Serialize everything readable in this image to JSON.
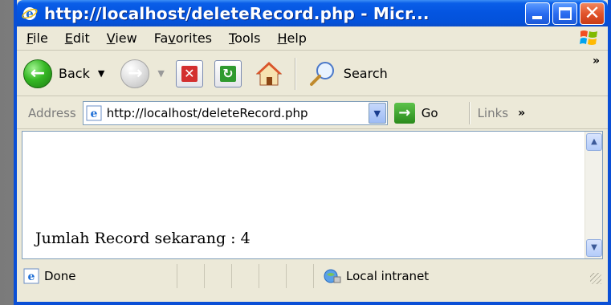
{
  "window": {
    "title": "http://localhost/deleteRecord.php - Micr..."
  },
  "menubar": {
    "items": [
      {
        "first": "F",
        "rest": "ile"
      },
      {
        "first": "E",
        "rest": "dit"
      },
      {
        "first": "V",
        "rest": "iew"
      },
      {
        "first": "Fa",
        "accel": "v",
        "rest": "orites"
      },
      {
        "first": "T",
        "rest": "ools"
      },
      {
        "first": "H",
        "rest": "elp"
      }
    ]
  },
  "toolbar": {
    "back_label": "Back",
    "search_label": "Search",
    "more_chevron": "»"
  },
  "addressbar": {
    "label": "Address",
    "url": "http://localhost/deleteRecord.php",
    "go_label": "Go",
    "links_label": "Links",
    "links_chevron": "»"
  },
  "content": {
    "text": "Jumlah Record sekarang : 4"
  },
  "statusbar": {
    "status": "Done",
    "zone": "Local intranet"
  },
  "colors": {
    "titlebar": "#0454e0",
    "chrome": "#ece9d8",
    "close_button": "#e2542b"
  }
}
